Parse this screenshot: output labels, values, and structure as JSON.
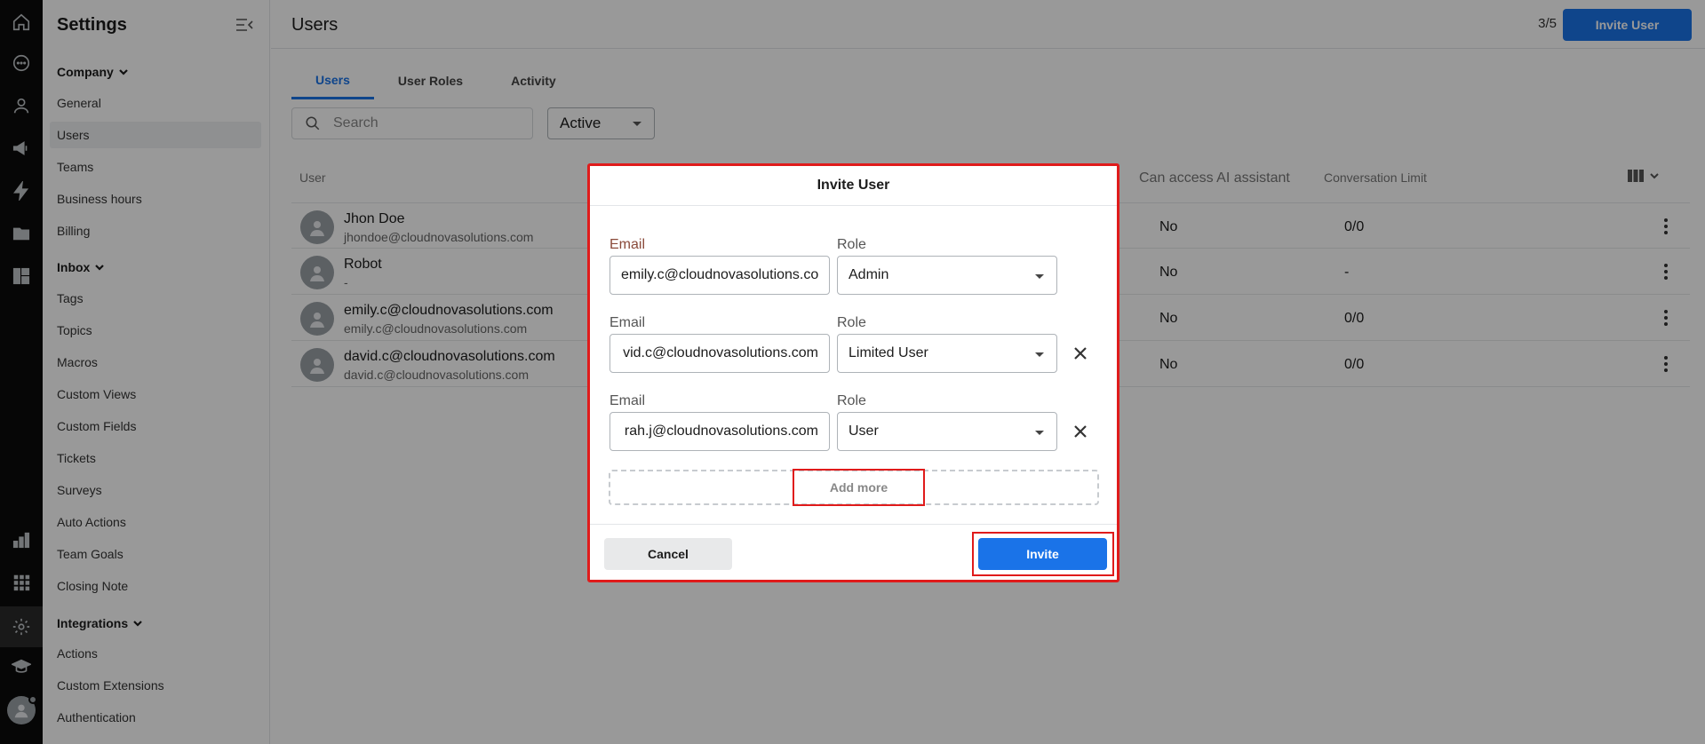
{
  "sidebar": {
    "title": "Settings",
    "sections": [
      {
        "label": "Company",
        "items": [
          "General",
          "Users",
          "Teams",
          "Business hours",
          "Billing"
        ]
      },
      {
        "label": "Inbox",
        "items": [
          "Tags",
          "Topics",
          "Macros",
          "Custom Views",
          "Custom Fields",
          "Tickets",
          "Surveys",
          "Auto Actions",
          "Team Goals",
          "Closing Note"
        ]
      },
      {
        "label": "Integrations",
        "items": [
          "Actions",
          "Custom Extensions",
          "Authentication"
        ]
      }
    ],
    "selected": "Users"
  },
  "header": {
    "title": "Users",
    "seat_count": "3/5",
    "invite_button": "Invite User"
  },
  "tabs": [
    "Users",
    "User Roles",
    "Activity"
  ],
  "filters": {
    "search_placeholder": "Search",
    "status": "Active"
  },
  "table": {
    "columns": [
      "User",
      "Can access AI assistant",
      "Conversation Limit"
    ],
    "rows": [
      {
        "name": "Jhon Doe",
        "email": "jhondoe@cloudnovasolutions.com",
        "ai": "No",
        "limit": "0/0"
      },
      {
        "name": "Robot",
        "email": "-",
        "ai": "No",
        "limit": "-"
      },
      {
        "name": "emily.c@cloudnovasolutions.com",
        "email": "emily.c@cloudnovasolutions.com",
        "ai": "No",
        "limit": "0/0"
      },
      {
        "name": "david.c@cloudnovasolutions.com",
        "email": "david.c@cloudnovasolutions.com",
        "ai": "No",
        "limit": "0/0"
      }
    ]
  },
  "modal": {
    "title": "Invite User",
    "email_label": "Email",
    "role_label": "Role",
    "invites": [
      {
        "email": "emily.c@cloudnovasolutions.co",
        "role": "Admin",
        "removable": false
      },
      {
        "email": "vid.c@cloudnovasolutions.com",
        "role": "Limited User",
        "removable": true
      },
      {
        "email": "rah.j@cloudnovasolutions.com",
        "role": "User",
        "removable": true
      }
    ],
    "add_more": "Add more",
    "cancel": "Cancel",
    "submit": "Invite"
  },
  "colors": {
    "primary": "#1a73e8",
    "highlight": "#e01b1b",
    "rail": "#0b0b0b"
  },
  "rail_icons": [
    "home-icon",
    "chat-icon",
    "contacts-icon",
    "campaigns-icon",
    "automation-icon",
    "knowledge-icon",
    "dashboard-icon",
    "reports-icon",
    "apps-icon",
    "settings-icon",
    "academy-icon",
    "profile-avatar"
  ]
}
